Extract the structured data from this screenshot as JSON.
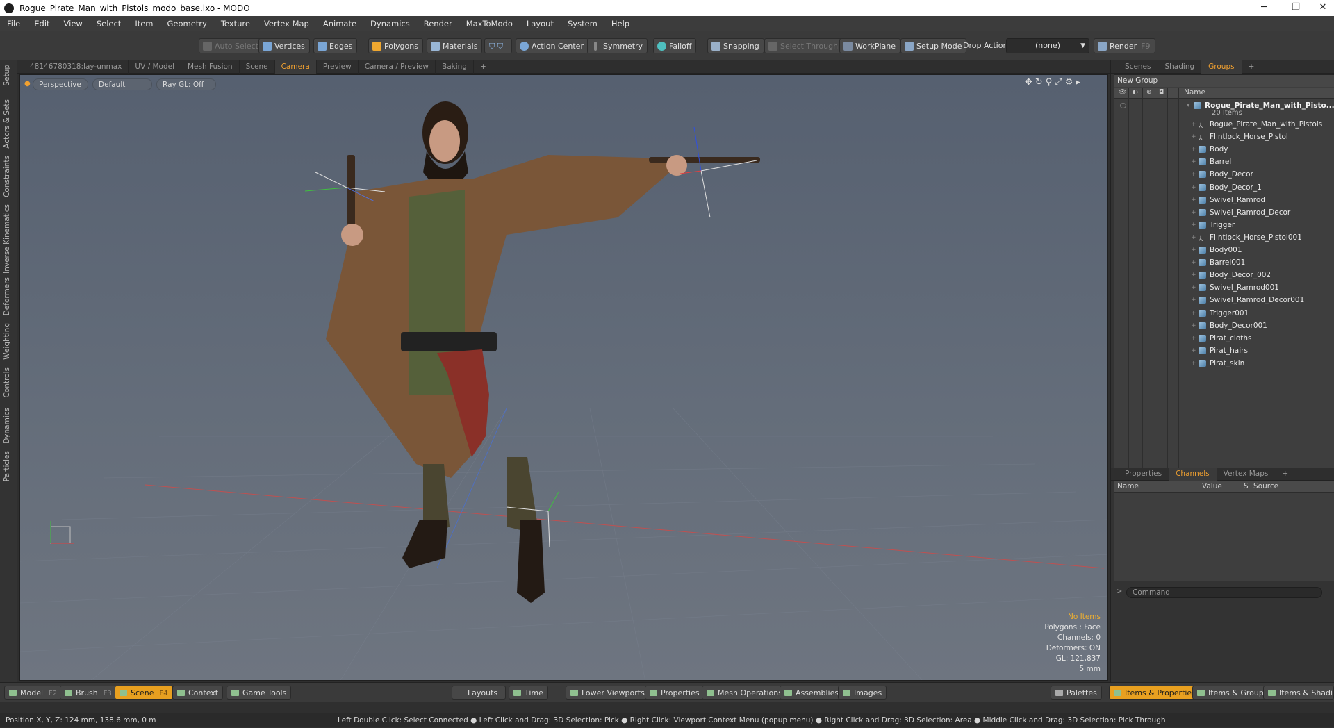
{
  "window": {
    "title": "Rogue_Pirate_Man_with_Pistols_modo_base.lxo - MODO",
    "min": "─",
    "restore": "❐",
    "close": "✕"
  },
  "menu": [
    "File",
    "Edit",
    "View",
    "Select",
    "Item",
    "Geometry",
    "Texture",
    "Vertex Map",
    "Animate",
    "Dynamics",
    "Render",
    "MaxToModo",
    "Layout",
    "System",
    "Help"
  ],
  "toolbar": {
    "auto_select": "Auto Select",
    "vertices": "Vertices",
    "edges": "Edges",
    "polygons": "Polygons",
    "materials": "Materials",
    "action_center": "Action Center",
    "symmetry": "Symmetry",
    "falloff": "Falloff",
    "snapping": "Snapping",
    "select_through": "Select Through",
    "workplane": "WorkPlane",
    "setup_mode": "Setup Mode",
    "drop_action_label": "Drop Action",
    "drop_action_value": "(none)",
    "render": "Render",
    "render_key": "F9"
  },
  "left_tabs": [
    "Setup",
    "Actors & Sets",
    "Constraints",
    "Inverse Kinematics",
    "Deformers",
    "Weighting",
    "Controls",
    "Dynamics",
    "Particles"
  ],
  "viewport_tabs": [
    "48146780318:lay-unmax",
    "UV / Model",
    "Mesh Fusion",
    "Scene",
    "Camera",
    "Preview",
    "Camera / Preview",
    "Baking",
    "+"
  ],
  "viewport_active_tab": "Camera",
  "viewport": {
    "view_mode": "Perspective",
    "shading": "Default",
    "raygl": "Ray GL: Off",
    "info": {
      "items": "No Items",
      "polygons": "Polygons : Face",
      "channels": "Channels: 0",
      "deformers": "Deformers: ON",
      "gl": "GL: 121,837",
      "scale": "5 mm"
    }
  },
  "right_tabs": [
    "Scenes",
    "Shading",
    "Groups",
    "+"
  ],
  "right_active_tab": "Groups",
  "groups": {
    "new_group": "New Group",
    "name_header": "Name",
    "root": {
      "name": "Rogue_Pirate_Man_with_Pisto...",
      "count": "20 Items"
    },
    "items": [
      {
        "name": "Rogue_Pirate_Man_with_Pistols",
        "type": "locator"
      },
      {
        "name": "Flintlock_Horse_Pistol",
        "type": "locator"
      },
      {
        "name": "Body",
        "type": "mesh"
      },
      {
        "name": "Barrel",
        "type": "mesh"
      },
      {
        "name": "Body_Decor",
        "type": "mesh"
      },
      {
        "name": "Body_Decor_1",
        "type": "mesh"
      },
      {
        "name": "Swivel_Ramrod",
        "type": "mesh"
      },
      {
        "name": "Swivel_Ramrod_Decor",
        "type": "mesh"
      },
      {
        "name": "Trigger",
        "type": "mesh"
      },
      {
        "name": "Flintlock_Horse_Pistol001",
        "type": "locator"
      },
      {
        "name": "Body001",
        "type": "mesh"
      },
      {
        "name": "Barrel001",
        "type": "mesh"
      },
      {
        "name": "Body_Decor_002",
        "type": "mesh"
      },
      {
        "name": "Swivel_Ramrod001",
        "type": "mesh"
      },
      {
        "name": "Swivel_Ramrod_Decor001",
        "type": "mesh"
      },
      {
        "name": "Trigger001",
        "type": "mesh"
      },
      {
        "name": "Body_Decor001",
        "type": "mesh"
      },
      {
        "name": "Pirat_cloths",
        "type": "mesh"
      },
      {
        "name": "Pirat_hairs",
        "type": "mesh"
      },
      {
        "name": "Pirat_skin",
        "type": "mesh"
      }
    ]
  },
  "prop_tabs": [
    "Properties",
    "Channels",
    "Vertex Maps",
    "+"
  ],
  "prop_active_tab": "Channels",
  "channels_header": {
    "name": "Name",
    "value": "Value",
    "s": "S",
    "source": "Source"
  },
  "command_placeholder": "Command",
  "bottom_bar": {
    "model": "Model",
    "model_key": "F2",
    "brush": "Brush",
    "brush_key": "F3",
    "scene": "Scene",
    "scene_key": "F4",
    "context": "Context",
    "game_tools": "Game Tools",
    "layouts": "Layouts",
    "time": "Time",
    "lower_viewports": "Lower Viewports",
    "properties": "Properties",
    "mesh_operations": "Mesh Operations",
    "assemblies": "Assemblies",
    "images": "Images",
    "palettes": "Palettes",
    "items_properties": "Items & Properties",
    "items_groups": "Items & Groups",
    "items_shading": "Items & Shading"
  },
  "status": {
    "position": "Position X, Y, Z:   124 mm, 138.6 mm, 0 m",
    "hints": "Left Double Click: Select Connected ● Left Click and Drag: 3D Selection: Pick ● Right Click: Viewport Context Menu (popup menu) ● Right Click and Drag: 3D Selection: Area ● Middle Click and Drag: 3D Selection: Pick Through"
  }
}
